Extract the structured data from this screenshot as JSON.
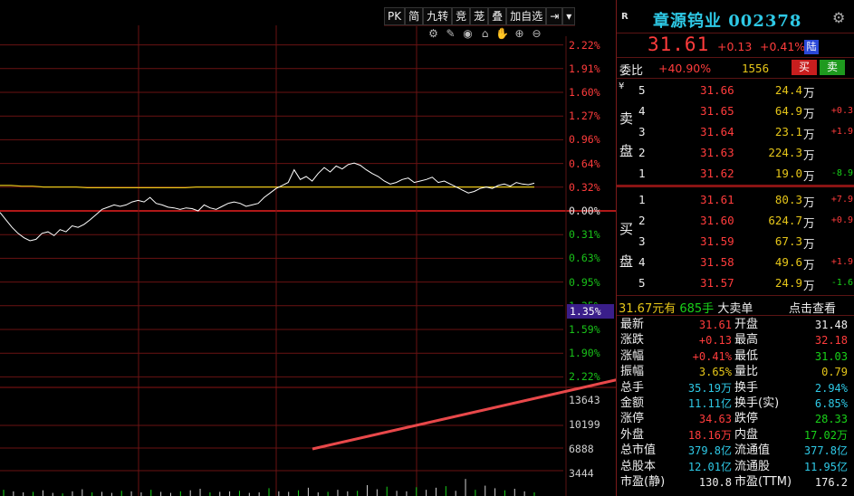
{
  "chart": {
    "toolbar": [
      "PK",
      "简",
      "九转",
      "竞",
      "茏",
      "叠",
      "加自选",
      "⇥",
      "▾"
    ],
    "icons": [
      "settings-wheel-icon",
      "pen-icon",
      "eye-icon",
      "bag-icon",
      "hand-icon",
      "zoom-in-icon",
      "zoom-out-icon"
    ],
    "price_axis": [
      {
        "label": "2.22%",
        "tone": "red"
      },
      {
        "label": "1.91%",
        "tone": "red"
      },
      {
        "label": "1.60%",
        "tone": "red"
      },
      {
        "label": "1.27%",
        "tone": "red"
      },
      {
        "label": "0.96%",
        "tone": "red"
      },
      {
        "label": "0.64%",
        "tone": "red"
      },
      {
        "label": "0.32%",
        "tone": "red"
      },
      {
        "label": "0.00%",
        "tone": "white"
      },
      {
        "label": "0.31%",
        "tone": "green"
      },
      {
        "label": "0.63%",
        "tone": "green"
      },
      {
        "label": "0.95%",
        "tone": "green"
      },
      {
        "label": "1.35%",
        "tone": "green"
      },
      {
        "label": "1.59%",
        "tone": "green"
      },
      {
        "label": "1.90%",
        "tone": "green"
      },
      {
        "label": "2.22%",
        "tone": "green"
      }
    ],
    "hover_label": "1.35%",
    "volume_axis": [
      "13643",
      "10199",
      "6888",
      "3444"
    ],
    "colors": {
      "up": "#ff3c3c",
      "down": "#19d219",
      "price_line": "#ffffff",
      "avg_line": "#e6c619",
      "grid": "#6a1212"
    }
  },
  "chart_data": {
    "type": "line",
    "series": [],
    "intraday_pct": [
      -0.02,
      -0.12,
      -0.22,
      -0.3,
      -0.36,
      -0.4,
      -0.38,
      -0.3,
      -0.28,
      -0.33,
      -0.25,
      -0.28,
      -0.2,
      -0.22,
      -0.18,
      -0.12,
      -0.05,
      0.02,
      0.05,
      0.08,
      0.06,
      0.08,
      0.12,
      0.14,
      0.12,
      0.18,
      0.1,
      0.08,
      0.05,
      0.04,
      0.02,
      0.04,
      0.03,
      0.0,
      0.08,
      0.04,
      0.02,
      0.06,
      0.1,
      0.12,
      0.1,
      0.06,
      0.08,
      0.1,
      0.18,
      0.24,
      0.3,
      0.34,
      0.38,
      0.55,
      0.42,
      0.46,
      0.4,
      0.5,
      0.58,
      0.52,
      0.6,
      0.56,
      0.62,
      0.64,
      0.61,
      0.55,
      0.5,
      0.46,
      0.4,
      0.36,
      0.38,
      0.42,
      0.44,
      0.38,
      0.4,
      0.42,
      0.45,
      0.38,
      0.4,
      0.36,
      0.32,
      0.28,
      0.24,
      0.26,
      0.3,
      0.32,
      0.3,
      0.34,
      0.36,
      0.33,
      0.38,
      0.36,
      0.35,
      0.37
    ],
    "avg_pct": [
      0.34,
      0.34,
      0.33,
      0.33,
      0.32,
      0.32,
      0.32,
      0.32,
      0.31,
      0.31,
      0.31,
      0.31,
      0.31,
      0.31,
      0.31,
      0.31,
      0.31,
      0.31,
      0.32,
      0.32,
      0.32,
      0.32,
      0.32,
      0.32,
      0.32,
      0.32,
      0.32,
      0.32,
      0.32,
      0.32,
      0.32,
      0.32,
      0.32,
      0.32,
      0.32,
      0.32,
      0.32,
      0.32,
      0.32,
      0.32,
      0.32,
      0.32,
      0.32,
      0.32,
      0.32,
      0.32,
      0.32,
      0.32,
      0.32,
      0.32
    ],
    "volumes": [
      1200,
      900,
      700,
      800,
      1100,
      600,
      500,
      900,
      1300,
      700,
      800,
      600,
      1000,
      900,
      700,
      1200,
      800,
      600,
      900,
      1100,
      1400,
      700,
      800,
      900,
      1000,
      600,
      700,
      1500,
      900,
      800,
      1100,
      1600,
      700,
      800,
      1200,
      900,
      1000,
      2100,
      1300,
      1800,
      1000,
      900,
      1700,
      1200,
      1600,
      1900,
      1000,
      3300,
      1200,
      2000,
      1500,
      1100,
      1400,
      900,
      700
    ],
    "ylim_pct": [
      -2.22,
      2.22
    ],
    "vol_max": 13643
  },
  "panel": {
    "r_badge": "R",
    "title": "章源钨业 002378",
    "price": "31.61",
    "change": "+0.13",
    "change_pct": "+0.41%",
    "market_badge": "陆",
    "weibi_label": "委比",
    "weibi_pct": "+40.90%",
    "weibi_diff": "1556",
    "buy_btn": "买",
    "sell_btn": "卖",
    "sell_label": [
      "卖",
      "盘"
    ],
    "buy_label": [
      "买",
      "盘"
    ],
    "asks": [
      {
        "level": "5",
        "price": "31.66",
        "vol": "24.4",
        "unit": "万",
        "delta": ""
      },
      {
        "level": "4",
        "price": "31.65",
        "vol": "64.9",
        "unit": "万",
        "delta": "+0.3"
      },
      {
        "level": "3",
        "price": "31.64",
        "vol": "23.1",
        "unit": "万",
        "delta": "+1.9"
      },
      {
        "level": "2",
        "price": "31.63",
        "vol": "224.3",
        "unit": "万",
        "delta": ""
      },
      {
        "level": "1",
        "price": "31.62",
        "vol": "19.0",
        "unit": "万",
        "delta": "-8.9"
      }
    ],
    "bids": [
      {
        "level": "1",
        "price": "31.61",
        "vol": "80.3",
        "unit": "万",
        "delta": "+7.9"
      },
      {
        "level": "2",
        "price": "31.60",
        "vol": "624.7",
        "unit": "万",
        "delta": "+0.9"
      },
      {
        "level": "3",
        "price": "31.59",
        "vol": "67.3",
        "unit": "万",
        "delta": ""
      },
      {
        "level": "4",
        "price": "31.58",
        "vol": "49.6",
        "unit": "万",
        "delta": "+1.9"
      },
      {
        "level": "5",
        "price": "31.57",
        "vol": "24.9",
        "unit": "万",
        "delta": "-1.6"
      }
    ],
    "big_order": {
      "price": "31.67元有",
      "qty": "685手",
      "text": "大卖单",
      "action": "点击查看"
    },
    "quote": [
      {
        "l1": "最新",
        "v1": "31.61",
        "c1": "red",
        "l2": "开盘",
        "v2": "31.48",
        "c2": "white"
      },
      {
        "l1": "涨跌",
        "v1": "+0.13",
        "c1": "red",
        "l2": "最高",
        "v2": "32.18",
        "c2": "red"
      },
      {
        "l1": "涨幅",
        "v1": "+0.41%",
        "c1": "red",
        "l2": "最低",
        "v2": "31.03",
        "c2": "green"
      },
      {
        "l1": "振幅",
        "v1": "3.65%",
        "c1": "yellow",
        "l2": "量比",
        "v2": "0.79",
        "c2": "yellow"
      },
      {
        "l1": "总手",
        "v1": "35.19万",
        "c1": "cyan",
        "l2": "换手",
        "v2": "2.94%",
        "c2": "cyan"
      },
      {
        "l1": "金额",
        "v1": "11.11亿",
        "c1": "cyan",
        "l2": "换手(实)",
        "v2": "6.85%",
        "c2": "cyan"
      },
      {
        "l1": "涨停",
        "v1": "34.63",
        "c1": "red",
        "l2": "跌停",
        "v2": "28.33",
        "c2": "green"
      },
      {
        "l1": "外盘",
        "v1": "18.16万",
        "c1": "red",
        "l2": "内盘",
        "v2": "17.02万",
        "c2": "green"
      },
      {
        "l1": "总市值",
        "v1": "379.8亿",
        "c1": "cyan",
        "l2": "流通值",
        "v2": "377.8亿",
        "c2": "cyan"
      },
      {
        "l1": "总股本",
        "v1": "12.01亿",
        "c1": "cyan",
        "l2": "流通股",
        "v2": "11.95亿",
        "c2": "cyan"
      },
      {
        "l1": "市盈(静)",
        "v1": "130.8",
        "c1": "white",
        "l2": "市盈(TTM)",
        "v2": "176.2",
        "c2": "white"
      }
    ]
  }
}
